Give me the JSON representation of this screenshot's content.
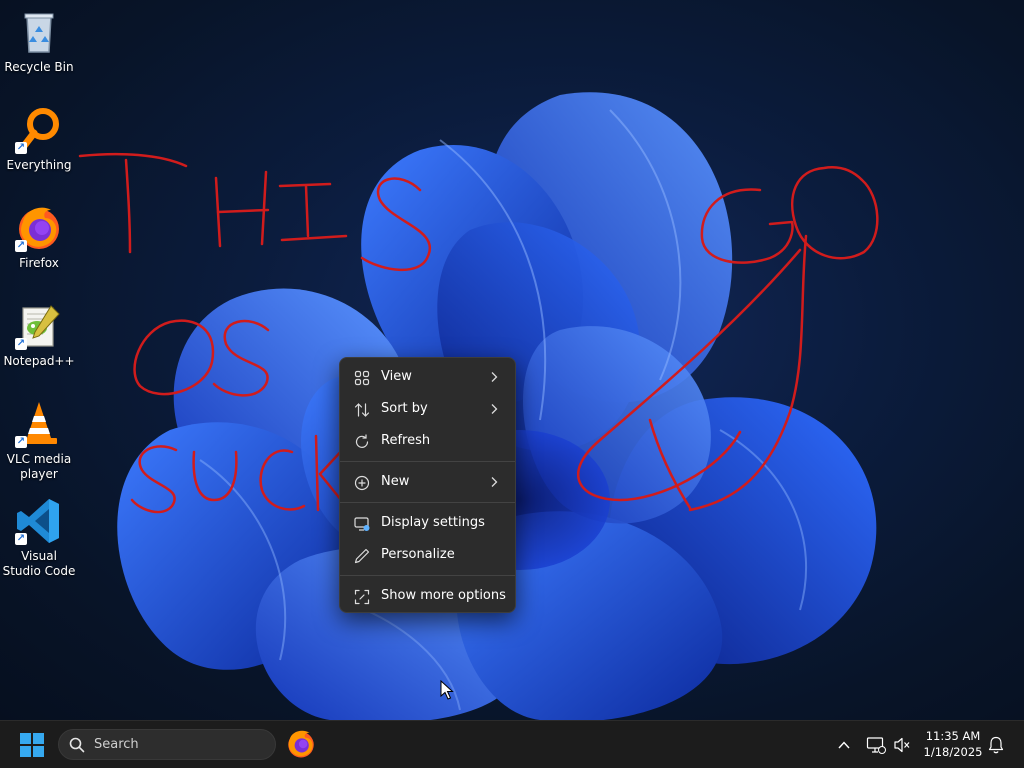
{
  "desktop": {
    "icons": [
      {
        "label": "Recycle Bin",
        "icon": "recycle-bin-icon",
        "shortcut": false
      },
      {
        "label": "Everything",
        "icon": "everything-search-icon",
        "shortcut": true
      },
      {
        "label": "Firefox",
        "icon": "firefox-icon",
        "shortcut": true
      },
      {
        "label": "Notepad++",
        "icon": "notepadpp-icon",
        "shortcut": true
      },
      {
        "label": "VLC media player",
        "icon": "vlc-cone-icon",
        "shortcut": true
      },
      {
        "label": "Visual Studio Code",
        "icon": "vscode-icon",
        "shortcut": true
      }
    ],
    "annotation": {
      "ink_color": "#d11c1c",
      "words": [
        "THIS",
        "OS",
        "SUCK",
        "GOD"
      ]
    }
  },
  "context_menu": {
    "items": [
      {
        "label": "View",
        "icon": "grid-view-icon",
        "submenu": true
      },
      {
        "label": "Sort by",
        "icon": "sort-arrows-icon",
        "submenu": true
      },
      {
        "label": "Refresh",
        "icon": "refresh-icon",
        "submenu": false
      },
      {
        "label": "New",
        "icon": "plus-circle-icon",
        "submenu": true
      },
      {
        "label": "Display settings",
        "icon": "display-settings-icon",
        "submenu": false
      },
      {
        "label": "Personalize",
        "icon": "pen-icon",
        "submenu": false
      },
      {
        "label": "Show more options",
        "icon": "expand-icon",
        "submenu": false
      }
    ]
  },
  "taskbar": {
    "search_placeholder": "Search",
    "pinned_apps": [
      "firefox-icon"
    ],
    "clock": {
      "time": "11:35 AM",
      "date": "1/18/2025"
    }
  },
  "colors": {
    "taskbar_bg": "#1c1c1c",
    "menu_bg": "#2c2c2c",
    "accent_blue": "#1f6fd6",
    "wallpaper_bloom": "#1e4fe0"
  }
}
